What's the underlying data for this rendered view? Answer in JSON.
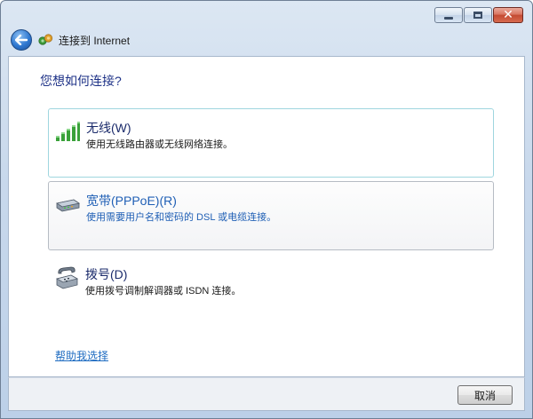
{
  "window": {
    "title": "连接到 Internet",
    "caption_buttons": [
      "minimize",
      "maximize",
      "close"
    ],
    "close_glyph": "✕"
  },
  "header": {
    "back_icon": "back-arrow-icon",
    "app_icon": "network-connection-icon"
  },
  "main": {
    "heading": "您想如何连接?",
    "options": [
      {
        "title": "无线(W)",
        "description": "使用无线路由器或无线网络连接。",
        "icon": "wireless-signal-icon",
        "state": "focused"
      },
      {
        "title": "宽带(PPPoE)(R)",
        "description": "使用需要用户名和密码的 DSL 或电缆连接。",
        "icon": "broadband-modem-icon",
        "state": "hover"
      },
      {
        "title": "拨号(D)",
        "description": "使用拨号调制解调器或 ISDN 连接。",
        "icon": "dialup-phone-icon",
        "state": "normal"
      }
    ],
    "help_link": "帮助我选择"
  },
  "footer": {
    "cancel_label": "取消"
  },
  "colors": {
    "heading": "#1e3287",
    "link": "#1f6cc1",
    "focus_border": "#9fd6df",
    "close_red": "#c34a32"
  }
}
